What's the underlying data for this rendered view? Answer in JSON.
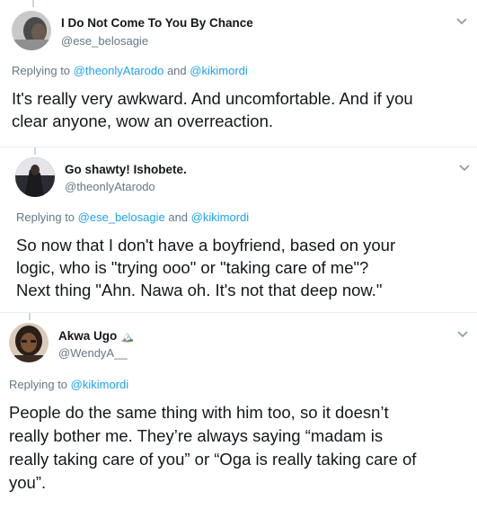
{
  "tweets": [
    {
      "display_name": "I Do Not Come To You By Chance",
      "handle": "@ese_belosagie",
      "replying_prefix": "Replying to",
      "replying_to_1": "@theonlyAtarodo",
      "replying_and": "and",
      "replying_to_2": "@kikimordi",
      "body_lines": [
        "It's really very awkward. And uncomfortable. And if you",
        "clear anyone, wow an overreaction."
      ]
    },
    {
      "display_name": "Go shawty! Ishobete.",
      "handle": "@theonlyAtarodo",
      "replying_prefix": "Replying to",
      "replying_to_1": "@ese_belosagie",
      "replying_and": "and",
      "replying_to_2": "@kikimordi",
      "body_lines": [
        "So now that I don't have a boyfriend, based on your",
        "logic, who is \"trying ooo\" or \"taking care of me\"?",
        "Next thing \"Ahn. Nawa oh. It's not that deep now.\""
      ]
    },
    {
      "display_name": "Akwa Ugo",
      "name_emoji": "🏔️",
      "handle": "@WendyA__",
      "replying_prefix": "Replying to",
      "replying_to_1": "@kikimordi",
      "body_lines": [
        "People do the same thing with him too, so it doesn’t",
        "really bother me. They’re always saying “madam is",
        "really taking care of you” or “Oga is really taking care of",
        "you”."
      ]
    }
  ],
  "icons": {
    "more_menu": "chevron-down-icon"
  },
  "colors": {
    "link": "#1da1f2",
    "secondary_text": "#657786",
    "primary_text": "#14171a",
    "separator": "#e6ecf0"
  }
}
